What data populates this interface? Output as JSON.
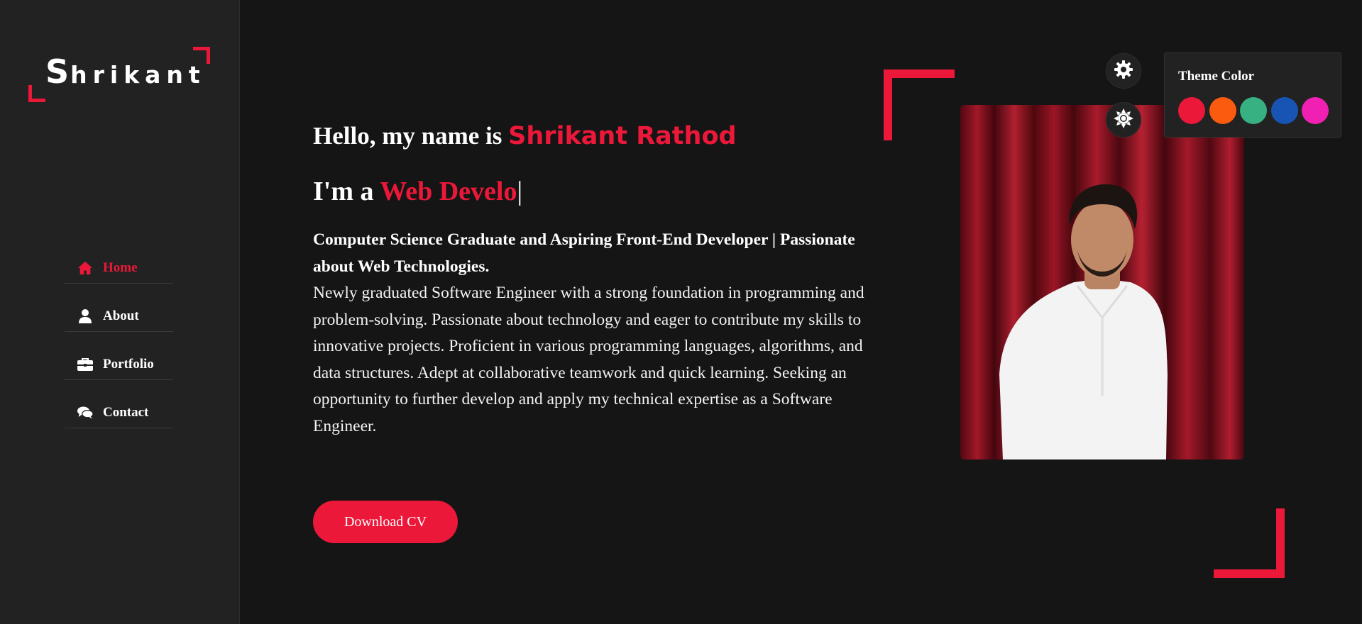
{
  "logo": {
    "first_letter": "S",
    "rest": "hrikant"
  },
  "nav": {
    "items": [
      {
        "label": "Home",
        "icon": "home-icon",
        "active": true
      },
      {
        "label": "About",
        "icon": "user-icon",
        "active": false
      },
      {
        "label": "Portfolio",
        "icon": "briefcase-icon",
        "active": false
      },
      {
        "label": "Contact",
        "icon": "comments-icon",
        "active": false
      }
    ]
  },
  "hero": {
    "greeting": "Hello, my name is ",
    "name": "Shrikant Rathod",
    "role_prefix": "I'm a ",
    "role_typed": "Web Develo",
    "cursor": "|",
    "headline": "Computer Science Graduate and Aspiring Front-End Developer | Passionate about Web Technologies.",
    "bio": "Newly graduated Software Engineer with a strong foundation in programming and problem-solving. Passionate about technology and eager to contribute my skills to innovative projects. Proficient in various programming languages, algorithms, and data structures. Adept at collaborative teamwork and quick learning. Seeking an opportunity to further develop and apply my technical expertise as a Software Engineer.",
    "download_label": "Download CV"
  },
  "theme": {
    "title": "Theme Color",
    "colors": [
      "#ec1839",
      "#fa5b0f",
      "#37b182",
      "#1854b4",
      "#f021b2"
    ]
  },
  "colors": {
    "accent": "#ec1839",
    "sidebar": "#222222",
    "background": "#151515"
  }
}
